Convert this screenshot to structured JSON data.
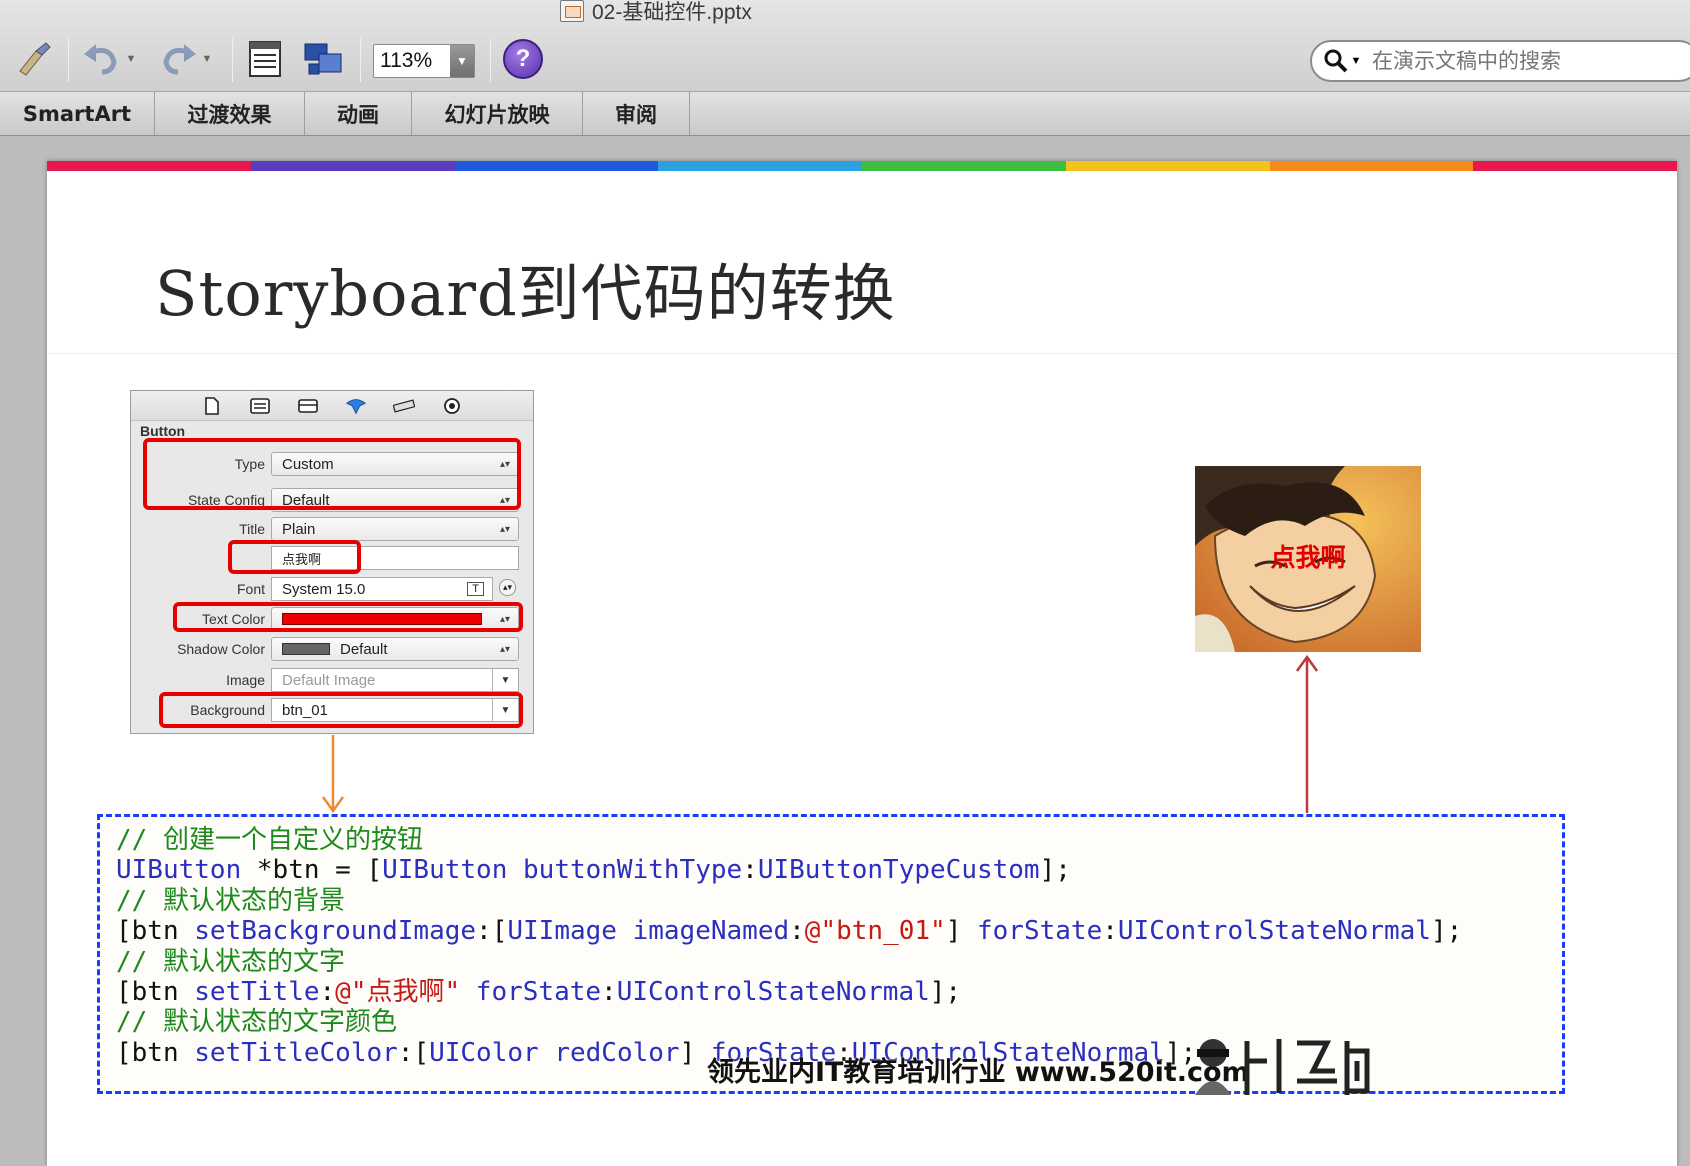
{
  "window": {
    "title": "02-基础控件.pptx"
  },
  "toolbar": {
    "zoom_value": "113%",
    "help_label": "?",
    "search_placeholder": "在演示文稿中的搜索"
  },
  "ribbon": {
    "tabs": [
      "SmartArt",
      "过渡效果",
      "动画",
      "幻灯片放映",
      "审阅"
    ]
  },
  "slide": {
    "title": "Storyboard到代码的转换",
    "rainbow_colors": [
      "#e8174d",
      "#5a3cbf",
      "#1e5ae0",
      "#2aa1e0",
      "#3fbf3f",
      "#f5c21a",
      "#f58a1a",
      "#e8174d"
    ]
  },
  "inspector": {
    "section": "Button",
    "rows": [
      {
        "label": "Type",
        "value": "Custom"
      },
      {
        "label": "State Config",
        "value": "Default"
      },
      {
        "label": "Title",
        "value": "Plain"
      },
      {
        "label": "",
        "value": "点我啊"
      },
      {
        "label": "Font",
        "value": "System 15.0"
      },
      {
        "label": "Text Color",
        "value": ""
      },
      {
        "label": "Shadow Color",
        "value": "Default"
      },
      {
        "label": "Image",
        "value": "Default Image"
      },
      {
        "label": "Background",
        "value": "btn_01"
      }
    ],
    "font_style_glyph": "T"
  },
  "preview": {
    "button_title": "点我啊"
  },
  "code": {
    "comment1": "// 创建一个自定义的按钮",
    "comment2": "// 默认状态的背景",
    "comment3": "// 默认状态的文字",
    "comment4": "// 默认状态的文字颜色"
  },
  "watermark": {
    "text": "领先业内IT教育培训行业 www.520it.com"
  }
}
